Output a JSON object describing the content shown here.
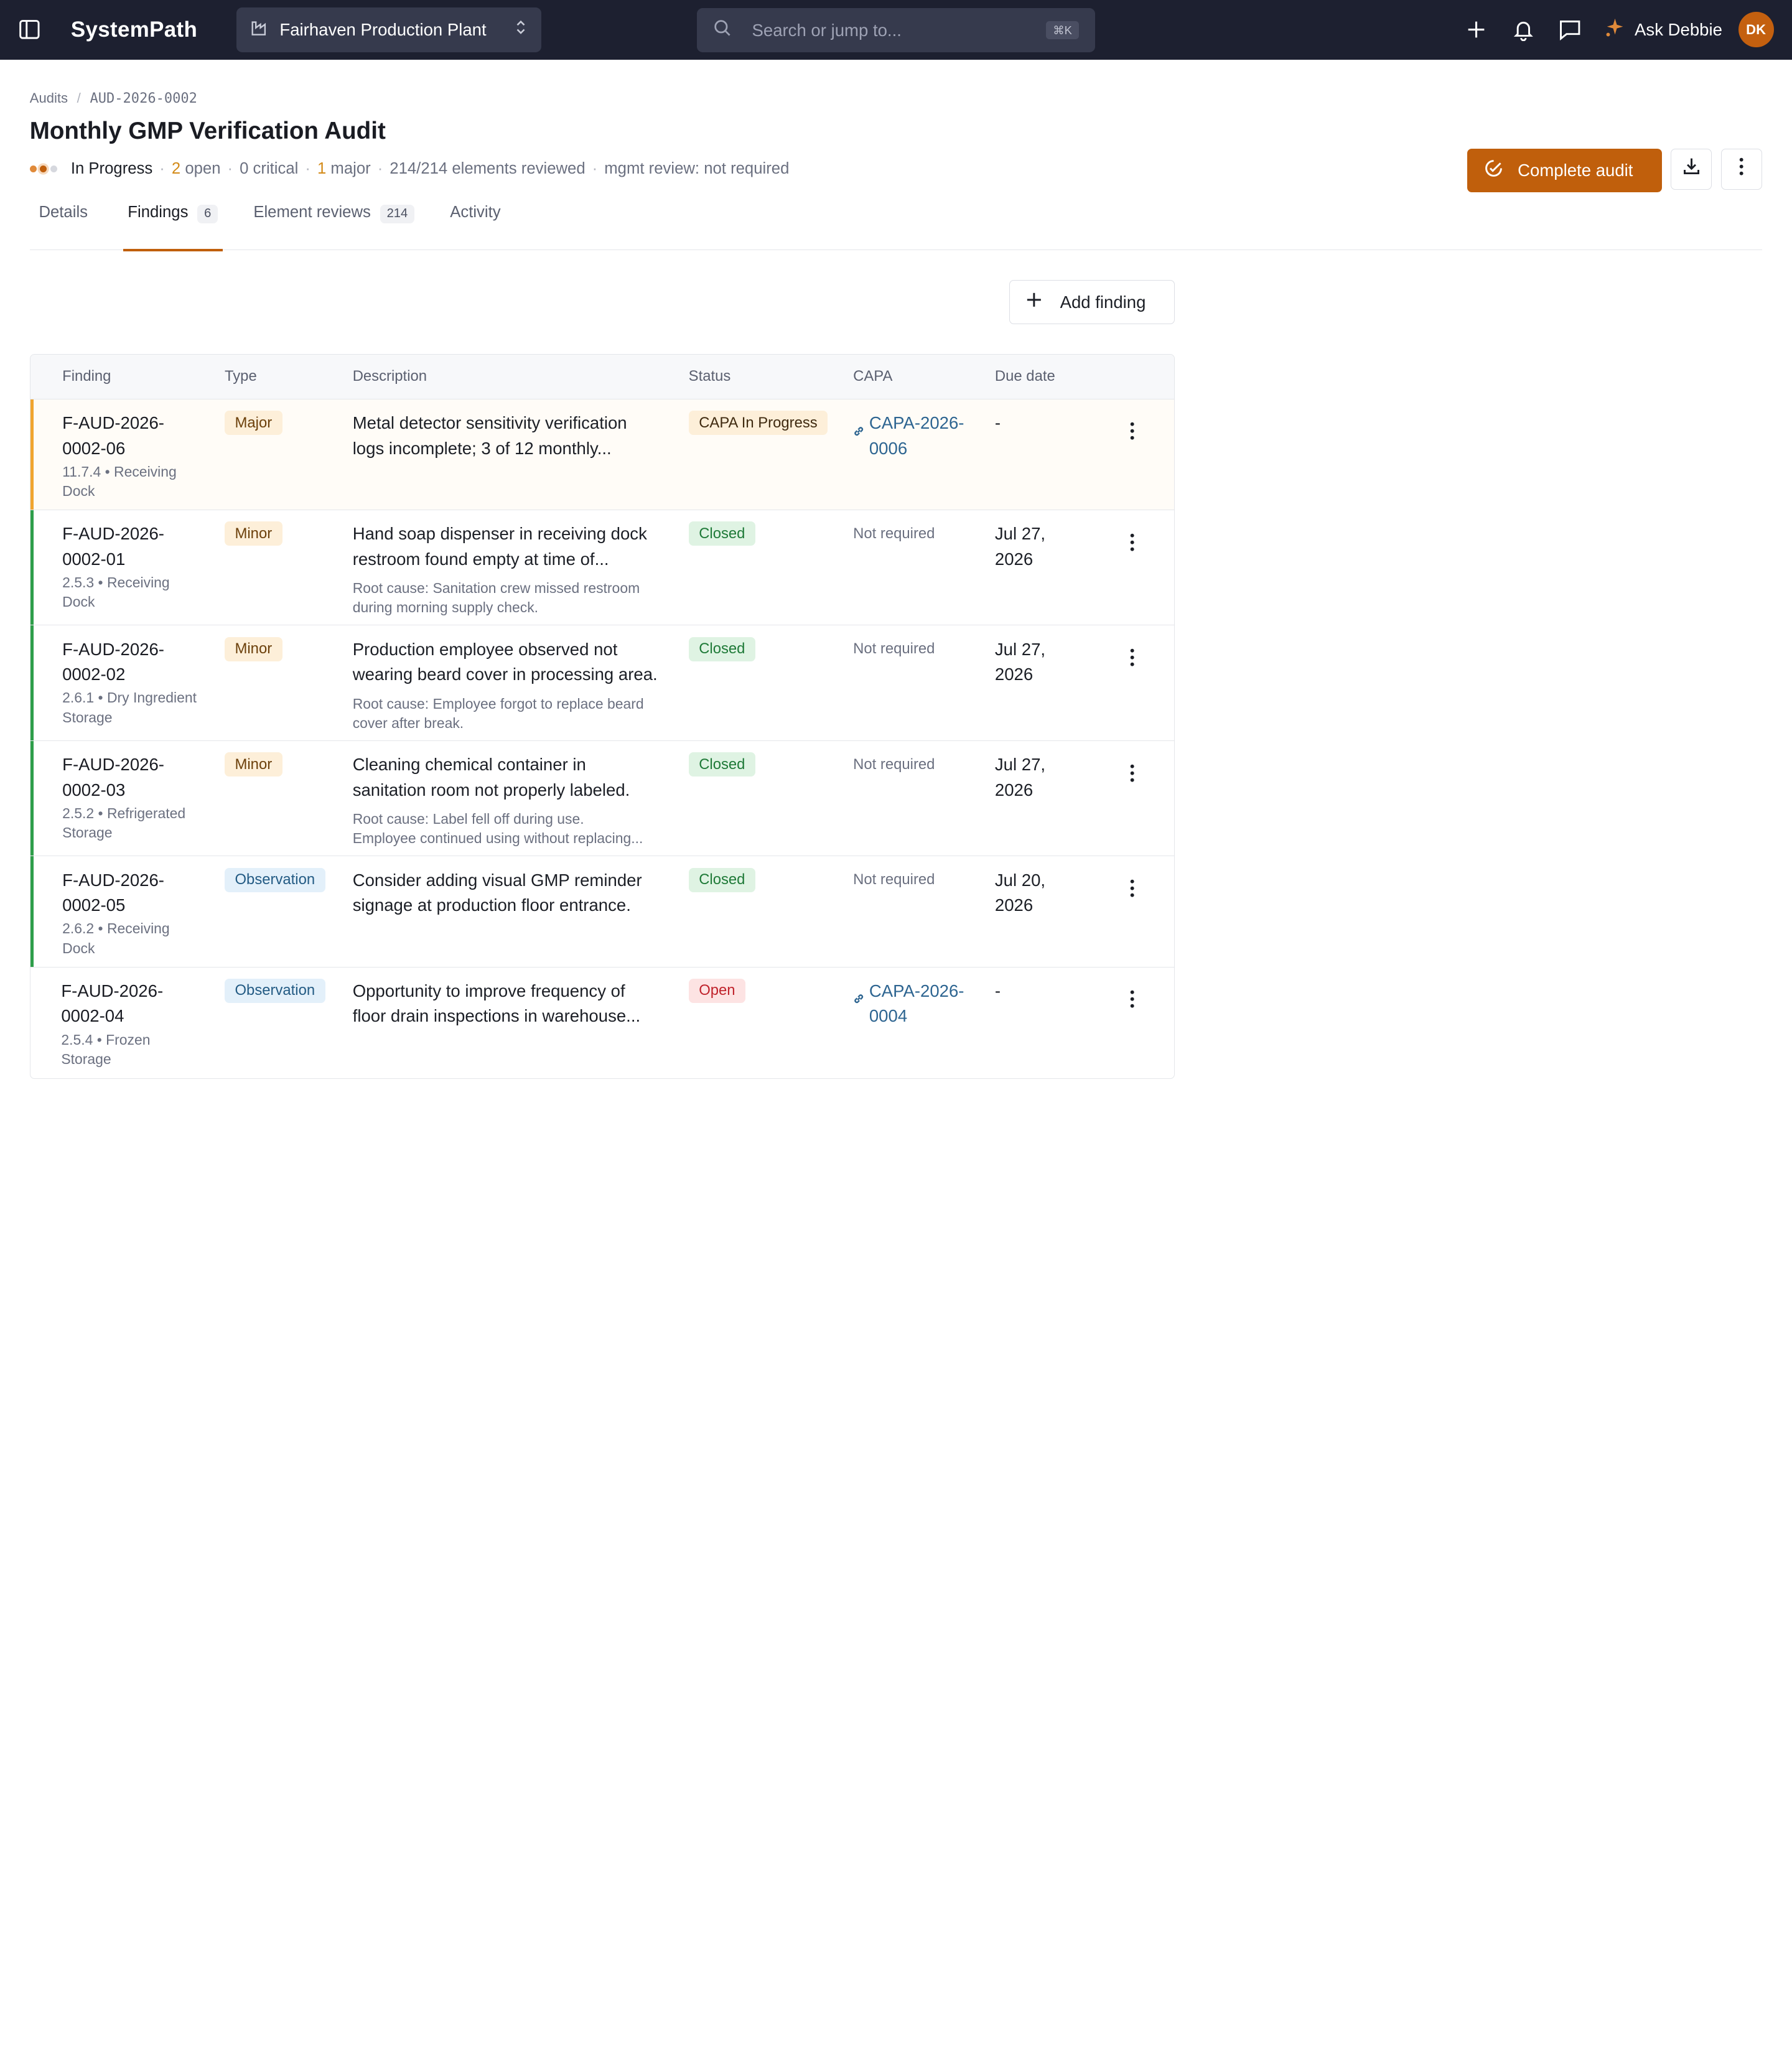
{
  "topbar": {
    "app_name": "SystemPath",
    "site": "Fairhaven Production Plant",
    "search_placeholder": "Search or jump to...",
    "search_shortcut": "⌘K",
    "assistant_label": "Ask Debbie",
    "avatar_initials": "DK"
  },
  "breadcrumb": {
    "parent": "Audits",
    "current": "AUD-2026-0002"
  },
  "header": {
    "title": "Monthly GMP Verification Audit",
    "status": "In Progress",
    "open_count": "2",
    "open_label": "open",
    "critical": "0 critical",
    "major_count": "1",
    "major_label": "major",
    "elements": "214/214 elements reviewed",
    "mgmt_review": "mgmt review: not required",
    "complete_label": "Complete audit"
  },
  "tabs": [
    {
      "label": "Details",
      "count": ""
    },
    {
      "label": "Findings",
      "count": "6"
    },
    {
      "label": "Element reviews",
      "count": "214"
    },
    {
      "label": "Activity",
      "count": ""
    }
  ],
  "add_finding_label": "Add finding",
  "table": {
    "columns": [
      "Finding",
      "Type",
      "Description",
      "Status",
      "CAPA",
      "Due date"
    ],
    "rows": [
      {
        "id_line1": "F-AUD-2026-",
        "id_line2": "0002-06",
        "sub_line1": "11.7.4 • Receiving",
        "sub_line2": "Dock",
        "type": "Major",
        "desc_line1": "Metal detector sensitivity verification",
        "desc_line2": "logs incomplete; 3 of 12 monthly...",
        "root_line1": "",
        "root_line2": "",
        "status": "CAPA In Progress",
        "capa_line1": "CAPA-2026-",
        "capa_line2": "0006",
        "due_line1": "-",
        "due_line2": ""
      },
      {
        "id_line1": "F-AUD-2026-",
        "id_line2": "0002-01",
        "sub_line1": "2.5.3 • Receiving",
        "sub_line2": "Dock",
        "type": "Minor",
        "desc_line1": "Hand soap dispenser in receiving dock",
        "desc_line2": "restroom found empty at time of...",
        "root_line1": "Root cause: Sanitation crew missed restroom",
        "root_line2": "during morning supply check.",
        "status": "Closed",
        "capa_text": "Not required",
        "due_line1": "Jul 27,",
        "due_line2": "2026"
      },
      {
        "id_line1": "F-AUD-2026-",
        "id_line2": "0002-02",
        "sub_line1": "2.6.1 • Dry Ingredient",
        "sub_line2": "Storage",
        "type": "Minor",
        "desc_line1": "Production employee observed not",
        "desc_line2": "wearing beard cover in processing area.",
        "root_line1": "Root cause: Employee forgot to replace beard",
        "root_line2": "cover after break.",
        "status": "Closed",
        "capa_text": "Not required",
        "due_line1": "Jul 27,",
        "due_line2": "2026"
      },
      {
        "id_line1": "F-AUD-2026-",
        "id_line2": "0002-03",
        "sub_line1": "2.5.2 • Refrigerated",
        "sub_line2": "Storage",
        "type": "Minor",
        "desc_line1": "Cleaning chemical container in",
        "desc_line2": "sanitation room not properly labeled.",
        "root_line1": "Root cause: Label fell off during use.",
        "root_line2": "Employee continued using without replacing...",
        "status": "Closed",
        "capa_text": "Not required",
        "due_line1": "Jul 27,",
        "due_line2": "2026"
      },
      {
        "id_line1": "F-AUD-2026-",
        "id_line2": "0002-05",
        "sub_line1": "2.6.2 • Receiving",
        "sub_line2": "Dock",
        "type": "Observation",
        "desc_line1": "Consider adding visual GMP reminder",
        "desc_line2": "signage at production floor entrance.",
        "root_line1": "",
        "root_line2": "",
        "status": "Closed",
        "capa_text": "Not required",
        "due_line1": "Jul 20,",
        "due_line2": "2026"
      },
      {
        "id_line1": "F-AUD-2026-",
        "id_line2": "0002-04",
        "sub_line1": "2.5.4 • Frozen",
        "sub_line2": "Storage",
        "type": "Observation",
        "desc_line1": "Opportunity to improve frequency of",
        "desc_line2": "floor drain inspections in warehouse...",
        "root_line1": "",
        "root_line2": "",
        "status": "Open",
        "capa_line1": "CAPA-2026-",
        "capa_line2": "0004",
        "due_line1": "-",
        "due_line2": ""
      }
    ]
  },
  "colors": {
    "accent": "#c05f0c",
    "topbar": "#1d2030",
    "row_bar_major": "#f0a530",
    "row_bar_closed": "#2e9e4a",
    "link": "#2e6591"
  }
}
